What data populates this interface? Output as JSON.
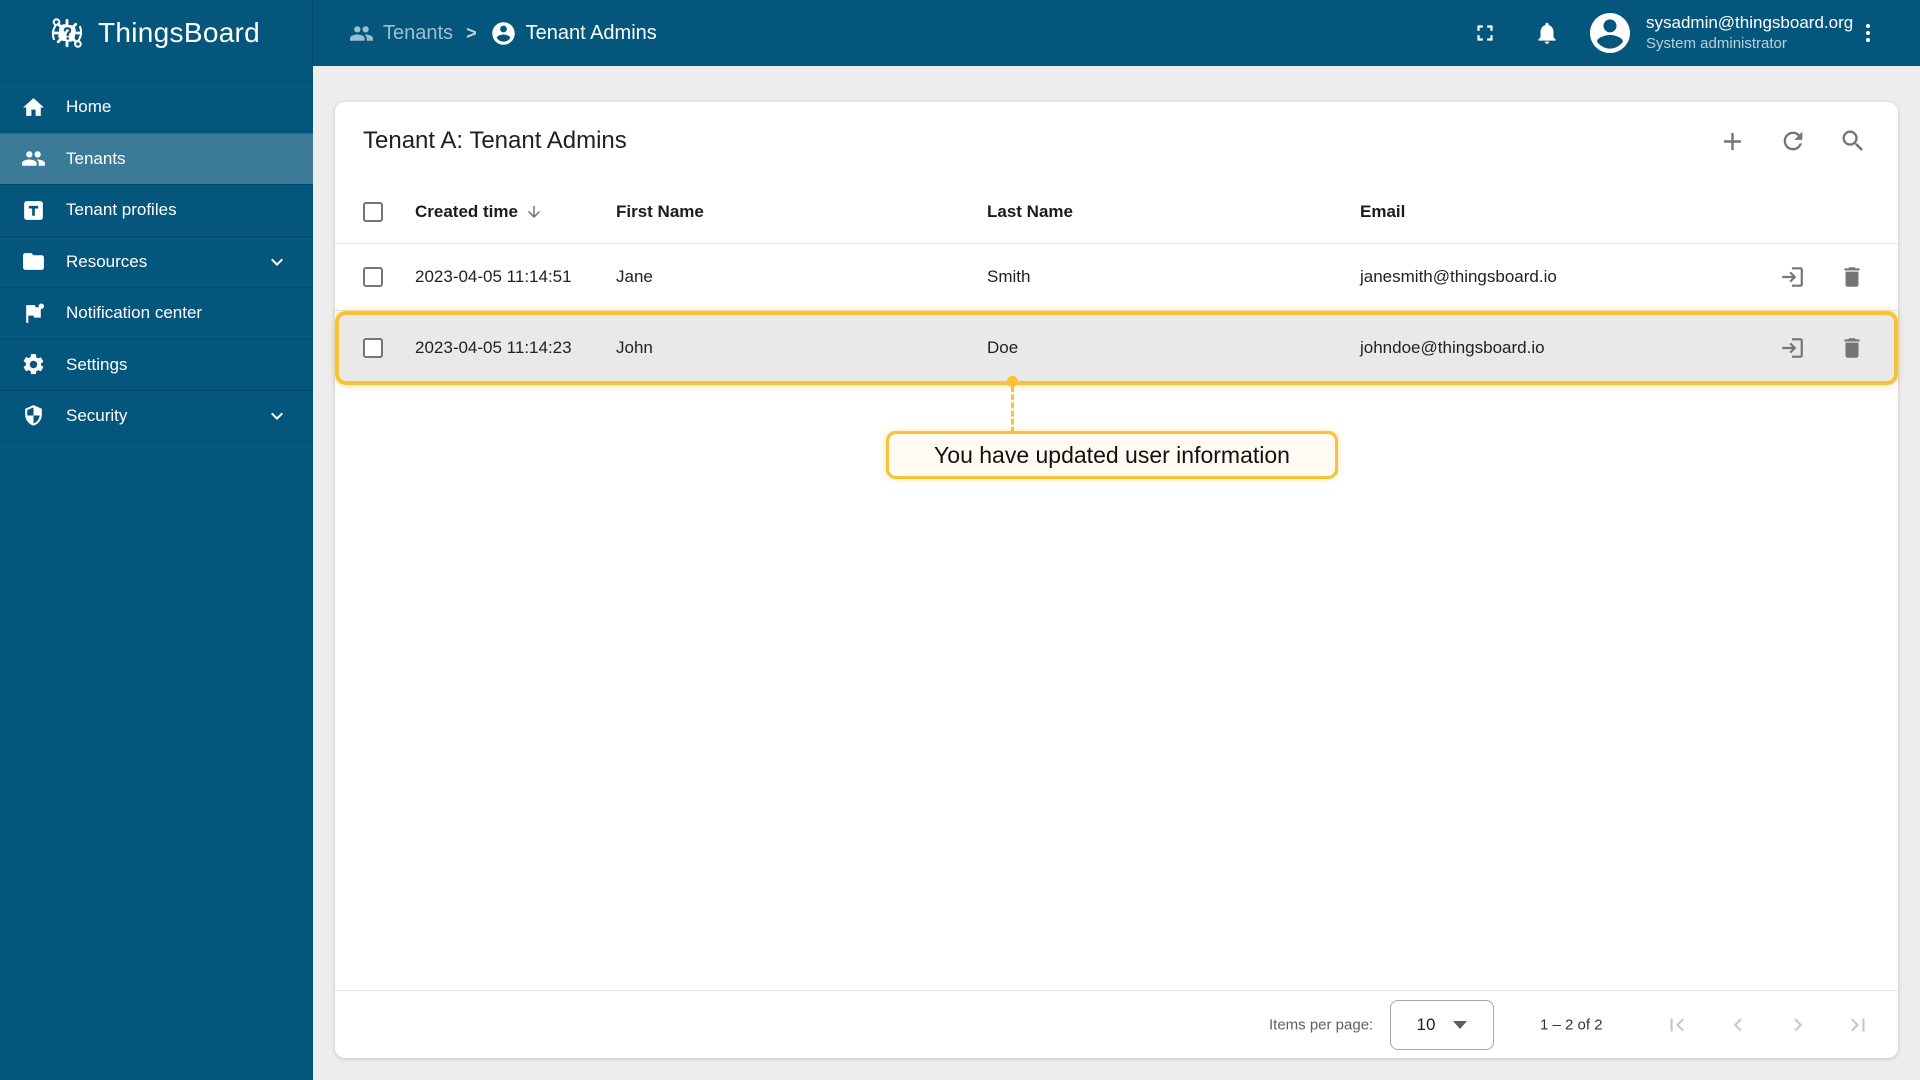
{
  "app": {
    "name": "ThingsBoard"
  },
  "colors": {
    "brand_primary": "#05567c",
    "accent_amber": "#F8C234"
  },
  "topbar": {
    "breadcrumb_separator": ">",
    "breadcrumb": [
      {
        "label": "Tenants",
        "icon": "people-icon"
      },
      {
        "label": "Tenant Admins",
        "icon": "account-circle-icon"
      }
    ],
    "icons": [
      "fullscreen-icon",
      "notifications-icon",
      "avatar-icon",
      "more-vert-icon"
    ],
    "user": {
      "email": "sysadmin@thingsboard.org",
      "role": "System administrator"
    }
  },
  "sidebar": {
    "items": [
      {
        "label": "Home",
        "icon": "home-icon",
        "selected": false
      },
      {
        "label": "Tenants",
        "icon": "people-icon",
        "selected": true
      },
      {
        "label": "Tenant profiles",
        "icon": "tenant-profile-icon",
        "selected": false
      },
      {
        "label": "Resources",
        "icon": "folder-icon",
        "selected": false,
        "expandable": true
      },
      {
        "label": "Notification center",
        "icon": "notification-flag-icon",
        "selected": false
      },
      {
        "label": "Settings",
        "icon": "settings-gear-icon",
        "selected": false
      },
      {
        "label": "Security",
        "icon": "security-shield-icon",
        "selected": false,
        "expandable": true
      }
    ]
  },
  "page": {
    "title": "Tenant A: Tenant Admins",
    "toolbar_icons": [
      "add-icon",
      "refresh-icon",
      "search-icon"
    ]
  },
  "table": {
    "columns": [
      {
        "label": "Created time",
        "sorted": "desc"
      },
      {
        "label": "First Name"
      },
      {
        "label": "Last Name"
      },
      {
        "label": "Email"
      }
    ],
    "row_action_icons": [
      "login-icon",
      "delete-icon"
    ],
    "rows": [
      {
        "created_time": "2023-04-05 11:14:51",
        "first_name": "Jane",
        "last_name": "Smith",
        "email": "janesmith@thingsboard.io",
        "highlighted": false
      },
      {
        "created_time": "2023-04-05 11:14:23",
        "first_name": "John",
        "last_name": "Doe",
        "email": "johndoe@thingsboard.io",
        "highlighted": true
      }
    ]
  },
  "tutorial": {
    "tooltip_text": "You have updated user information"
  },
  "pagination": {
    "items_per_page_label": "Items per page:",
    "items_per_page_value": "10",
    "range_text": "1 – 2 of 2",
    "nav_icons": [
      "first-page-icon",
      "chevron-left-icon",
      "chevron-right-icon",
      "last-page-icon"
    ]
  }
}
